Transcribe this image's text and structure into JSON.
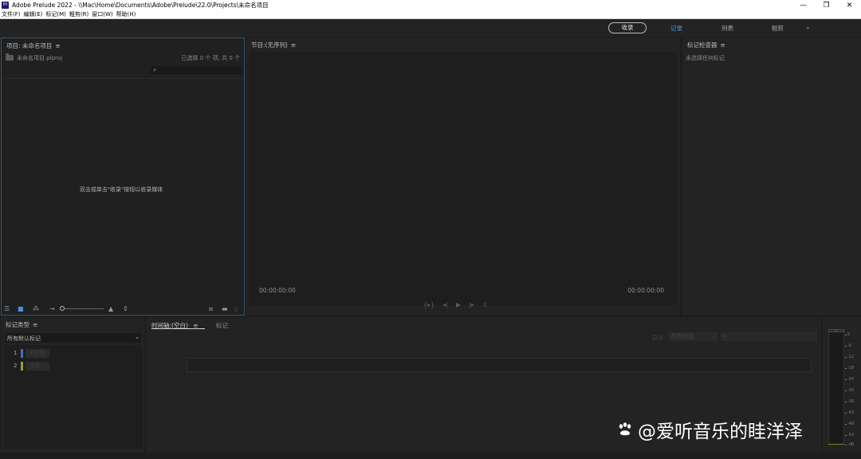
{
  "window": {
    "app_icon": "Pl",
    "title": "Adobe Prelude 2022 - \\\\Mac\\Home\\Documents\\Adobe\\Prelude\\22.0\\Projects\\未命名项目",
    "minimize": "—",
    "restore": "❐",
    "close": "✕"
  },
  "menu": [
    "文件(F)",
    "编辑(E)",
    "标记(M)",
    "粗剪(R)",
    "窗口(W)",
    "帮助(H)"
  ],
  "workspaces": {
    "ingest": "收录",
    "log": "记录",
    "list": "列表",
    "rough_cut": "粗剪",
    "more": "⌄",
    "active_color": "#4a9ee8"
  },
  "project_panel": {
    "title": "项目: 未命名项目",
    "menu_icon": "≡",
    "file_name": "未命名项目.plproj",
    "selection_status": "已选择 0 个 项, 共 0 个",
    "search_icon": "⌕",
    "empty_hint": "双击或单击\"收录\"按钮以收录媒体",
    "border_color": "#2f5878",
    "footer_icons": [
      "list-view-icon",
      "icon-view-icon",
      "freeform-view-icon",
      "sort-icon",
      "zoom-slider",
      "mountains-icon",
      "sort-order-icon",
      "new-rough-cut-icon",
      "new-bin-icon",
      "trash-icon"
    ]
  },
  "program_panel": {
    "title": "节目:(无序列)",
    "menu_icon": "≡",
    "timecode_in": "00:00:00:00",
    "timecode_out": "00:00:00:00",
    "transport": [
      "step-back-frame-icon",
      "prev-marker-icon",
      "play-icon",
      "next-marker-icon",
      "export-frame-icon"
    ]
  },
  "marker_inspector": {
    "title": "标记检查器",
    "menu_icon": "≡",
    "empty_text": "未选择任何标记"
  },
  "marker_type_panel": {
    "title": "标记类型",
    "menu_icon": "≡",
    "select_label": "所有默认标记",
    "select_arrow": "⌄",
    "items": [
      {
        "num": "1",
        "label": "子剪辑",
        "color": "#3f73b8"
      },
      {
        "num": "2",
        "label": "注释",
        "color": "#8aa63a"
      }
    ]
  },
  "timeline_panel": {
    "tab_active": "时间轴:(空白)",
    "tab_menu_icon": "≡",
    "tab_markers": "标记",
    "show_label": "显示:",
    "show_select": "所有标记",
    "show_arrow": "⌄",
    "search_icon": "⌕"
  },
  "audio_meter": {
    "scale": [
      "0",
      "-6",
      "-12",
      "-18",
      "-24",
      "-30",
      "-36",
      "-42",
      "-48",
      "-54",
      "-dB"
    ]
  },
  "watermark": {
    "text": "@爱听音乐的眭洋泽"
  }
}
